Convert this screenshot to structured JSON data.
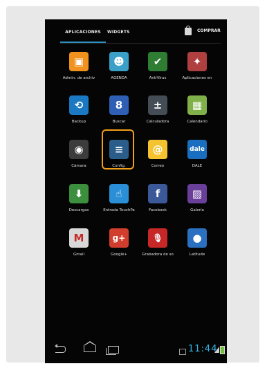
{
  "tabs": [
    {
      "label": "APLICACIONES",
      "active": true
    },
    {
      "label": "WIDGETS",
      "active": false
    }
  ],
  "store": {
    "label": "COMPRAR",
    "icon": "store-bag-icon"
  },
  "apps": [
    {
      "label": "Admin. de archiv",
      "icon": "folder-icon",
      "color": "#f0921d",
      "glyph": "▣"
    },
    {
      "label": "AGENDA",
      "icon": "contacts-icon",
      "color": "#3aa0c8",
      "glyph": "☻"
    },
    {
      "label": "AntiVirus",
      "icon": "antivirus-icon",
      "color": "#2e7d32",
      "glyph": "✔"
    },
    {
      "label": "Aplicaciones en",
      "icon": "apps-manager-icon",
      "color": "#b04040",
      "glyph": "✦"
    },
    {
      "label": "Backup",
      "icon": "backup-icon",
      "color": "#1b78c2",
      "glyph": "⟲"
    },
    {
      "label": "Buscar",
      "icon": "search-icon",
      "color": "#2f5fb5",
      "glyph": "8"
    },
    {
      "label": "Calculadora",
      "icon": "calculator-icon",
      "color": "#444c55",
      "glyph": "±"
    },
    {
      "label": "Calendario",
      "icon": "calendar-icon",
      "color": "#7fb04a",
      "glyph": "▦"
    },
    {
      "label": "Cámara",
      "icon": "camera-icon",
      "color": "#3c3c3c",
      "glyph": "◉"
    },
    {
      "label": "Config.",
      "icon": "settings-icon",
      "color": "#2b5d8a",
      "glyph": "≡"
    },
    {
      "label": "Correo",
      "icon": "email-icon",
      "color": "#f5c330",
      "glyph": "@"
    },
    {
      "label": "DALE",
      "icon": "dale-icon",
      "color": "#1a6ec0",
      "glyph": "dale"
    },
    {
      "label": "Descargas",
      "icon": "download-icon",
      "color": "#3c8f3c",
      "glyph": "⬇"
    },
    {
      "label": "Entrada TouchPa",
      "icon": "touchpal-icon",
      "color": "#2a8fd6",
      "glyph": "☝"
    },
    {
      "label": "Facebook",
      "icon": "facebook-icon",
      "color": "#3b5998",
      "glyph": "f"
    },
    {
      "label": "Galería",
      "icon": "gallery-icon",
      "color": "#6a3f9a",
      "glyph": "▨"
    },
    {
      "label": "Gmail",
      "icon": "gmail-icon",
      "color": "#d8d8d8",
      "glyph": "M"
    },
    {
      "label": "Google+",
      "icon": "google-plus-icon",
      "color": "#d13e2e",
      "glyph": "g+"
    },
    {
      "label": "Grabadora de so",
      "icon": "microphone-icon",
      "color": "#c62828",
      "glyph": "🎙"
    },
    {
      "label": "Latitude",
      "icon": "latitude-icon",
      "color": "#2b6fc0",
      "glyph": "●"
    }
  ],
  "status": {
    "time": "11:44"
  }
}
